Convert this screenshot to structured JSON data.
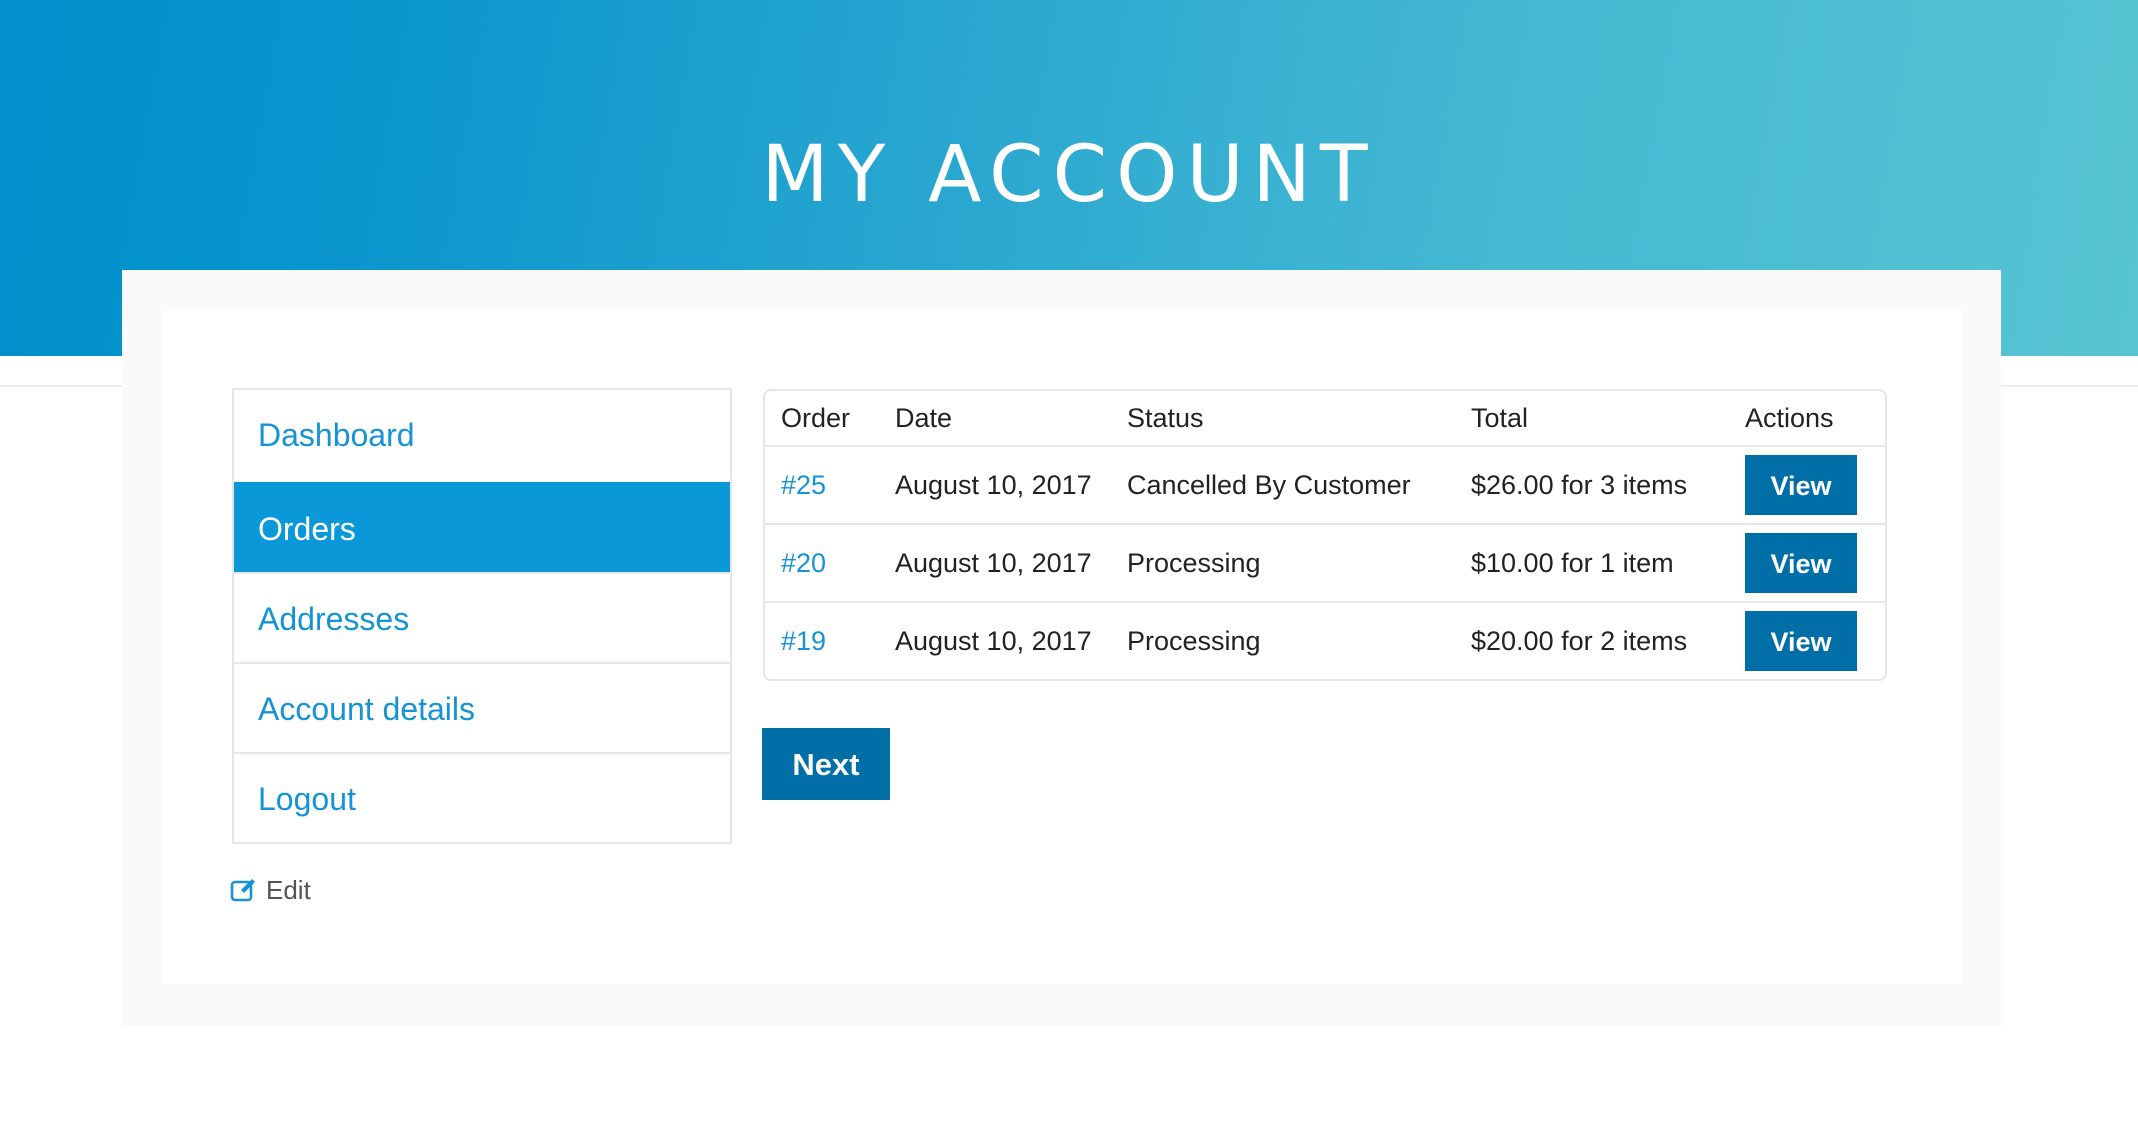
{
  "header": {
    "title": "MY ACCOUNT"
  },
  "colors": {
    "hero_gradient_start": "#0190cc",
    "hero_gradient_end": "#56c4d2",
    "accent": "#0a98d9",
    "link": "#1593d6",
    "button": "#006fa8"
  },
  "sidebar": {
    "items": [
      {
        "label": "Dashboard",
        "active": false
      },
      {
        "label": "Orders",
        "active": true
      },
      {
        "label": "Addresses",
        "active": false
      },
      {
        "label": "Account details",
        "active": false
      },
      {
        "label": "Logout",
        "active": false
      }
    ],
    "edit_label": "Edit",
    "edit_icon": "edit-icon"
  },
  "orders": {
    "columns": [
      "Order",
      "Date",
      "Status",
      "Total",
      "Actions"
    ],
    "rows": [
      {
        "order": "#25",
        "date": "August 10, 2017",
        "status": "Cancelled By Customer",
        "total": "$26.00 for 3 items",
        "action": "View"
      },
      {
        "order": "#20",
        "date": "August 10, 2017",
        "status": "Processing",
        "total": "$10.00 for 1 item",
        "action": "View"
      },
      {
        "order": "#19",
        "date": "August 10, 2017",
        "status": "Processing",
        "total": "$20.00 for 2 items",
        "action": "View"
      }
    ],
    "next_label": "Next"
  }
}
